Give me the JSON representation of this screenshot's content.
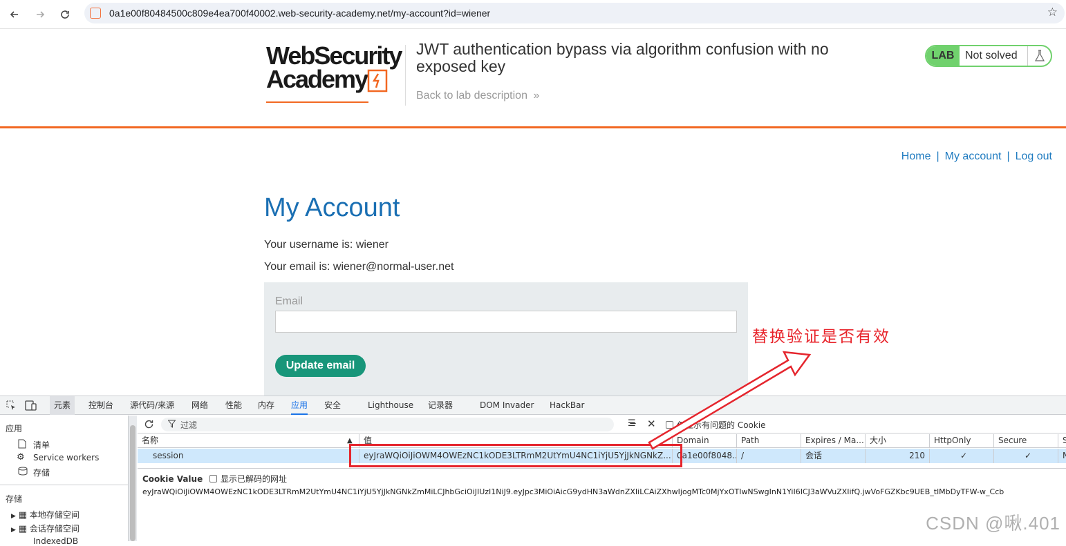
{
  "browser": {
    "url": "0a1e00f80484500c809e4ea700f40002.web-security-academy.net/my-account?id=wiener"
  },
  "lab": {
    "logo_line1": "WebSecurity",
    "logo_line2": "Academy",
    "title": "JWT authentication bypass via algorithm confusion with no exposed key",
    "back_link": "Back to lab description",
    "back_link_arrow": "»",
    "badge": "LAB",
    "status": "Not solved"
  },
  "nav": {
    "home": "Home",
    "my_account": "My account",
    "log_out": "Log out",
    "separator": "|"
  },
  "account": {
    "title": "My Account",
    "username_line": "Your username is: wiener",
    "email_line": "Your email is: wiener@normal-user.net",
    "email_label": "Email",
    "email_value": "",
    "update_button": "Update email"
  },
  "annotation": {
    "text": "替换验证是否有效",
    "color": "#e8242b"
  },
  "devtools": {
    "tabs": [
      "元素",
      "控制台",
      "源代码/来源",
      "网络",
      "性能",
      "内存",
      "应用",
      "安全",
      "Lighthouse",
      "记录器",
      "DOM Invader",
      "HackBar"
    ],
    "active_tab": "应用",
    "sidebar": {
      "section_app": "应用",
      "manifest": "清单",
      "service_workers": "Service workers",
      "storage": "存储",
      "section_storage": "存储",
      "local_storage": "本地存储空间",
      "session_storage": "会话存储空间",
      "indexeddb": "IndexedDB"
    },
    "filter_placeholder": "过滤",
    "only_issues_label": "仅显示有问题的 Cookie",
    "columns": [
      "名称",
      "值",
      "Domain",
      "Path",
      "Expires / Ma...",
      "大小",
      "HttpOnly",
      "Secure",
      "S"
    ],
    "row": {
      "name": "session",
      "value": "eyJraWQiOiJiOWM4OWEzNC1kODE3LTRmM2UtYmU4NC1iYjU5YjJkNGNkZ...",
      "domain": "0a1e00f8048...",
      "path": "/",
      "expires": "会话",
      "size": "210",
      "httponly": "✓",
      "secure": "✓",
      "samesite": "N"
    },
    "cookie_value_label": "Cookie Value",
    "show_decoded_label": "显示已解码的网址",
    "cookie_full_value": "eyJraWQiOiJiOWM4OWEzNC1kODE3LTRmM2UtYmU4NC1iYjU5YjJkNGNkZmMiLCJhbGciOiJIUzI1NiJ9.eyJpc3MiOiAicG9ydHN3aWdnZXIiLCAiZXhwIjogMTc0MjYxOTIwNSwgInN1YiI6ICJ3aWVuZXIifQ.jwVoFGZKbc9UEB_tlMbDyTFW-w_Ccb"
  },
  "watermark": "CSDN @啾.401"
}
